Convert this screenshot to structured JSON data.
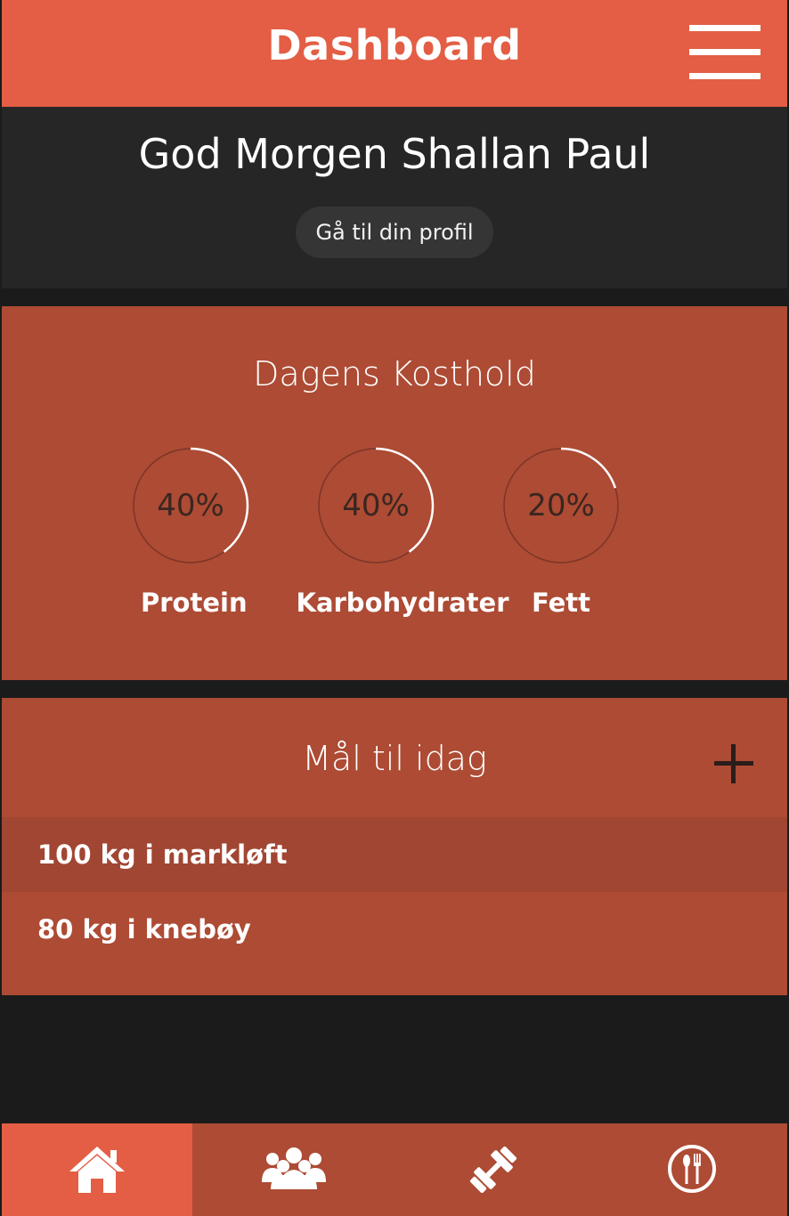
{
  "header": {
    "title": "Dashboard",
    "menu_icon": "hamburger-menu-icon"
  },
  "greeting": {
    "title": "God Morgen Shallan Paul",
    "profile_button": "Gå til din profil"
  },
  "diet": {
    "title": "Dagens Kosthold",
    "macros": [
      {
        "label": "Protein",
        "percent": 40,
        "percent_text": "40%"
      },
      {
        "label": "Karbohydrater",
        "percent": 40,
        "percent_text": "40%"
      },
      {
        "label": "Fett",
        "percent": 20,
        "percent_text": "20%"
      }
    ]
  },
  "goals": {
    "title": "Mål til idag",
    "add_icon": "plus-icon",
    "items": [
      {
        "label": "100 kg i markløft"
      },
      {
        "label": "80 kg i knebøy"
      }
    ]
  },
  "nav": {
    "active_index": 0,
    "items": [
      {
        "icon": "home-icon"
      },
      {
        "icon": "group-icon"
      },
      {
        "icon": "dumbbell-icon"
      },
      {
        "icon": "utensils-icon"
      }
    ]
  },
  "colors": {
    "accent": "#e35e44",
    "section": "#ad4b34",
    "dark": "#262626",
    "row_alt": "#a14633"
  }
}
